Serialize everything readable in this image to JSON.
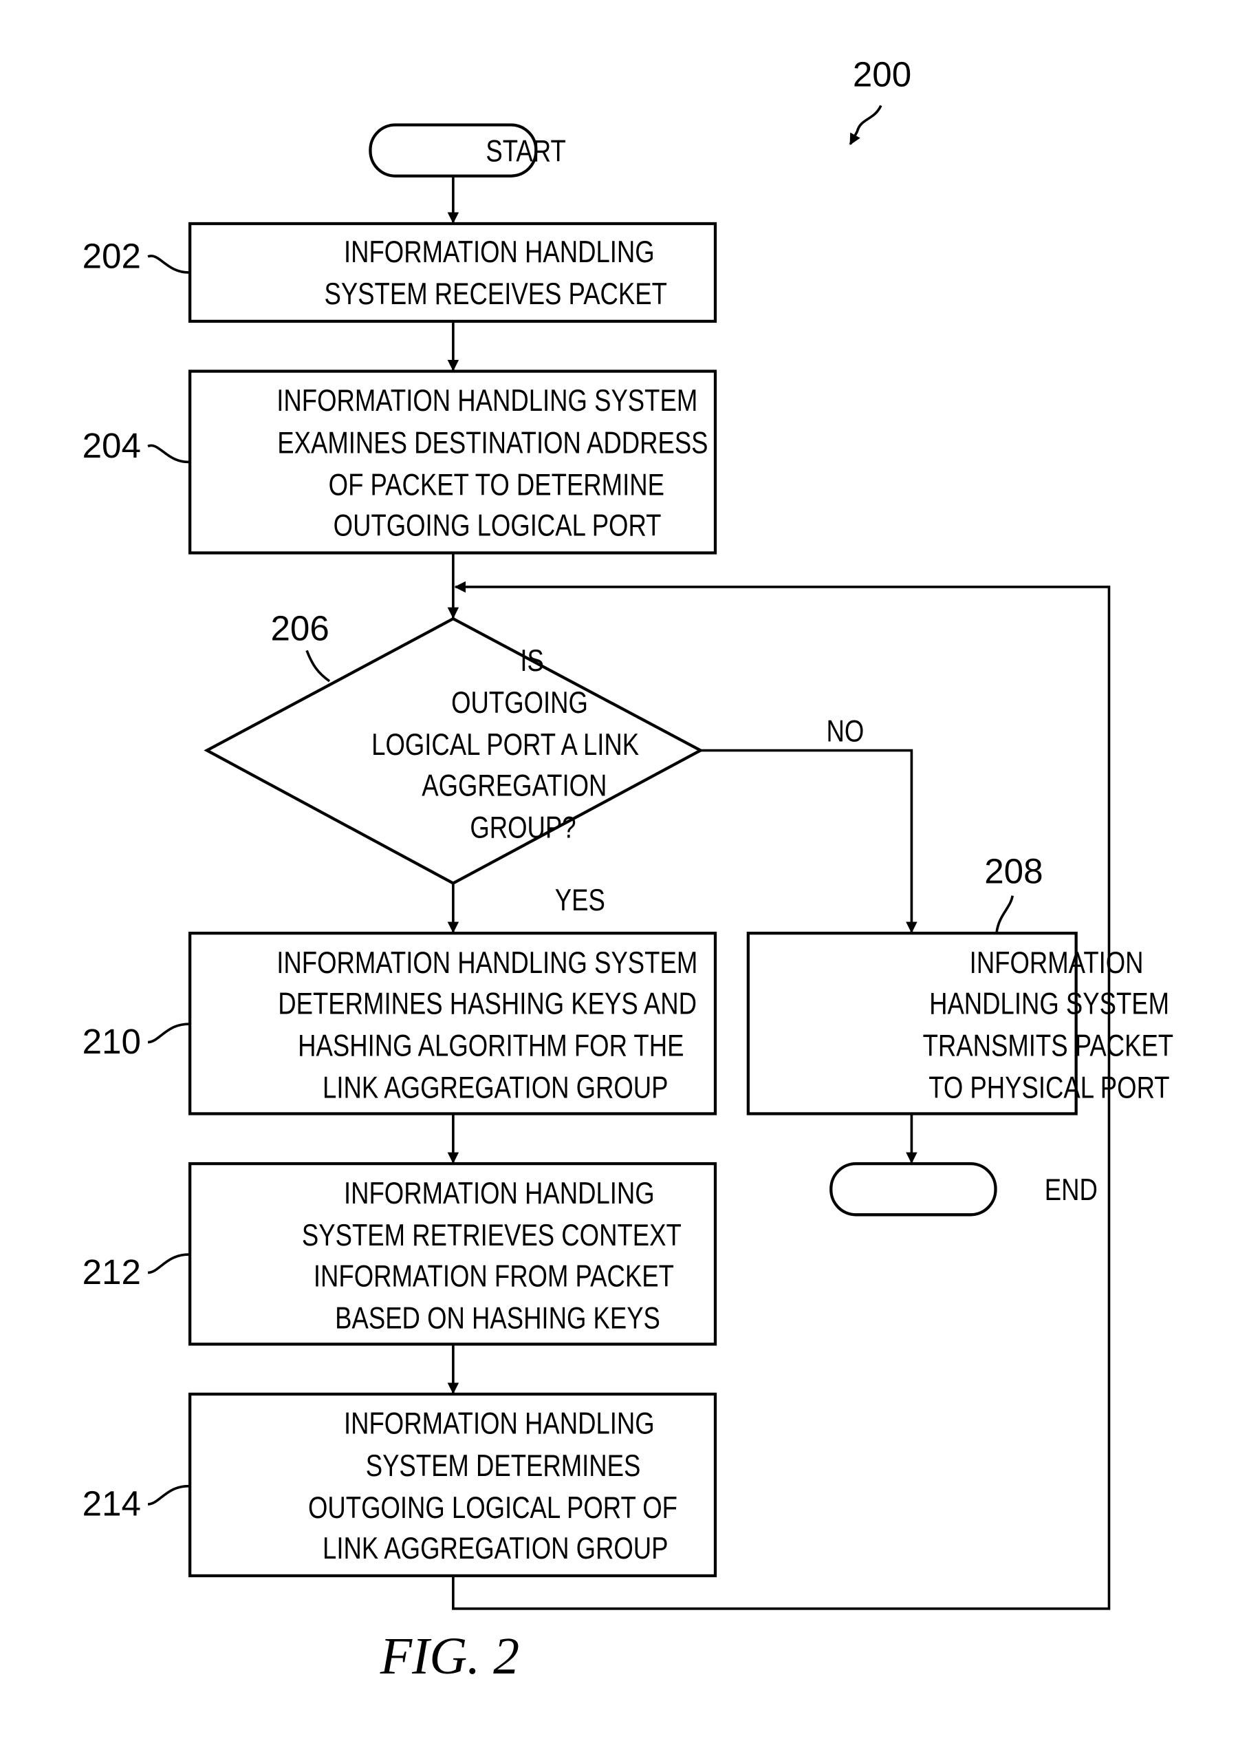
{
  "figure": {
    "reference_number": "200",
    "caption": "FIG. 2"
  },
  "nodes": {
    "start": {
      "label": "START"
    },
    "end": {
      "label": "END"
    },
    "n202": {
      "ref": "202",
      "lines": [
        "INFORMATION HANDLING",
        "SYSTEM RECEIVES PACKET"
      ]
    },
    "n204": {
      "ref": "204",
      "lines": [
        "INFORMATION HANDLING SYSTEM",
        "EXAMINES DESTINATION ADDRESS",
        "OF PACKET TO DETERMINE",
        "OUTGOING LOGICAL PORT"
      ]
    },
    "n206": {
      "ref": "206",
      "lines": [
        "IS",
        "OUTGOING",
        "LOGICAL PORT A LINK",
        "AGGREGATION",
        "GROUP?"
      ],
      "yes_label": "YES",
      "no_label": "NO"
    },
    "n208": {
      "ref": "208",
      "lines": [
        "INFORMATION",
        "HANDLING SYSTEM",
        "TRANSMITS PACKET",
        "TO PHYSICAL PORT"
      ]
    },
    "n210": {
      "ref": "210",
      "lines": [
        "INFORMATION HANDLING SYSTEM",
        "DETERMINES HASHING KEYS AND",
        "HASHING ALGORITHM FOR THE",
        "LINK AGGREGATION GROUP"
      ]
    },
    "n212": {
      "ref": "212",
      "lines": [
        "INFORMATION HANDLING",
        "SYSTEM RETRIEVES CONTEXT",
        "INFORMATION FROM PACKET",
        "BASED ON HASHING KEYS"
      ]
    },
    "n214": {
      "ref": "214",
      "lines": [
        "INFORMATION HANDLING",
        "SYSTEM DETERMINES",
        "OUTGOING LOGICAL PORT OF",
        "LINK AGGREGATION GROUP"
      ]
    }
  },
  "edges": [
    {
      "from": "start",
      "to": "n202",
      "label": ""
    },
    {
      "from": "n202",
      "to": "n204",
      "label": ""
    },
    {
      "from": "n204",
      "to": "n206",
      "label": ""
    },
    {
      "from": "n206",
      "to": "n210",
      "label": "YES"
    },
    {
      "from": "n206",
      "to": "n208",
      "label": "NO"
    },
    {
      "from": "n208",
      "to": "end",
      "label": ""
    },
    {
      "from": "n210",
      "to": "n212",
      "label": ""
    },
    {
      "from": "n212",
      "to": "n214",
      "label": ""
    },
    {
      "from": "n214",
      "to": "n206",
      "label": ""
    }
  ]
}
